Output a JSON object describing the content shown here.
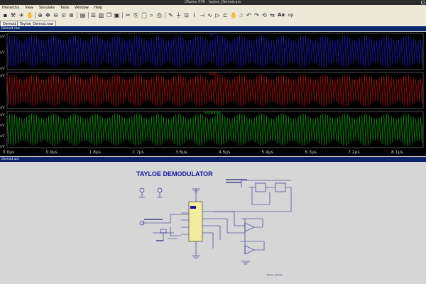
{
  "window": {
    "title": "LTspice XVII - tayloe_Demod.asc"
  },
  "menu": [
    "Hierarchy",
    "View",
    "Simulate",
    "Tools",
    "Window",
    "Help"
  ],
  "toolbar_icons": [
    "save-icon",
    "control-panel-icon",
    "run-icon",
    "halt-icon",
    "zoom-in-icon",
    "pan-icon",
    "zoom-out-icon",
    "zoom-fit-icon",
    "cancel-zoom-icon",
    "tile-horizontal-icon",
    "tile-vertical-icon",
    "close-window-icon",
    "cut-icon",
    "copy-icon",
    "paste-icon",
    "find-icon",
    "print-icon",
    "print-preview-icon",
    "wire-icon",
    "ground-icon",
    "label-net-icon",
    "resistor-icon",
    "capacitor-icon",
    "inductor-icon",
    "diode-icon",
    "component-icon",
    "move-icon",
    "drag-icon",
    "undo-icon",
    "redo-icon",
    "rotate-icon",
    "mirror-icon",
    "text-icon",
    "spice-directive-icon"
  ],
  "tabs": [
    {
      "label": "Demod.raw"
    },
    {
      "label": "Tayloe_Demod.raw"
    }
  ],
  "plot_panel": {
    "title": "Demod.raw"
  },
  "schematic_panel": {
    "title": "Demod.asc"
  },
  "waveforms": [
    {
      "label": "V(i)",
      "color": "#2020d0",
      "ylabels": [
        "uV",
        "uV",
        "uV"
      ]
    },
    {
      "label": "V(q)",
      "color": "#c81414",
      "ylabels": [
        "uV",
        "uV"
      ]
    },
    {
      "label": "V(n008)",
      "color": "#10b010",
      "ylabels": [
        "uV",
        "uV",
        "uV",
        "uV"
      ]
    }
  ],
  "x_axis": {
    "ticks": [
      "0.0µs",
      "0.9µs",
      "1.8µs",
      "2.7µs",
      "3.6µs",
      "4.5µs",
      "5.4µs",
      "6.3µs",
      "7.2µs",
      "8.1µs"
    ]
  },
  "schematic": {
    "title": "TAYLOE DEMODULATOR",
    "footer_note": "tayloe_demod"
  }
}
